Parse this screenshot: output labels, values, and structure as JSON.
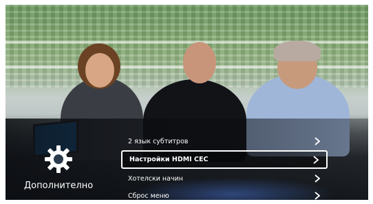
{
  "settings_panel": {
    "section_title": "Дополнително",
    "icon": "gear-icon",
    "menu_items": [
      {
        "label": "2 язык субтитров"
      },
      {
        "label": "Настройки HDMI CEC",
        "selected": true
      },
      {
        "label": "Хотелски начин"
      },
      {
        "label": "Сброс меню"
      }
    ]
  },
  "colors": {
    "highlight_border": "#ffffff",
    "text": "#ffffff"
  }
}
